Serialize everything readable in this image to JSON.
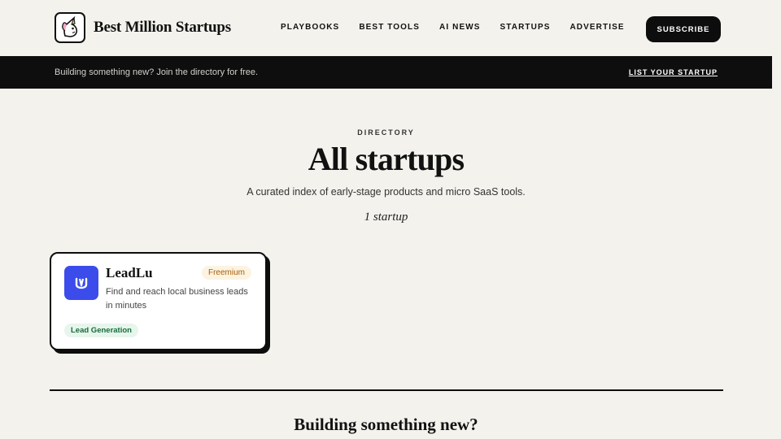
{
  "brand": {
    "name": "Best Million Startups",
    "logo_icon": "unicorn-icon"
  },
  "nav": {
    "items": [
      "PLAYBOOKS",
      "BEST TOOLS",
      "AI NEWS",
      "STARTUPS",
      "ADVERTISE"
    ]
  },
  "header": {
    "subscribe_label": "SUBSCRIBE"
  },
  "banner": {
    "text": "Building something new? Join the directory for free.",
    "link_label": "LIST YOUR STARTUP"
  },
  "hero": {
    "eyebrow": "DIRECTORY",
    "title": "All startups",
    "subtitle": "A curated index of early-stage products and micro SaaS tools.",
    "count": "1 startup"
  },
  "startups": [
    {
      "name": "LeadLu",
      "pricing": "Freemium",
      "description": "Find and reach local business leads in minutes",
      "tag": "Lead Generation",
      "icon": "leadlu-logo-icon",
      "icon_color": "#3b4cea"
    }
  ],
  "footer_cta": {
    "title": "Building something new?"
  },
  "colors": {
    "background": "#f3f2ed",
    "dark": "#0d0d0d",
    "accent_blue": "#3b4cea",
    "badge_orange": "#a85d06",
    "tag_green": "#176a3c"
  }
}
